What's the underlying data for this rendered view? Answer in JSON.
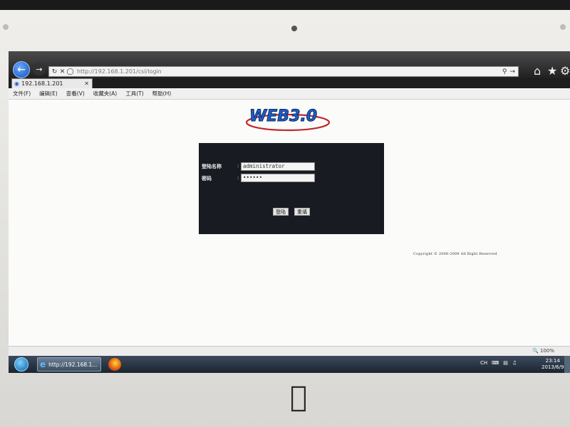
{
  "browser": {
    "address_url": "http://192.168.1.201/csl/login",
    "tab_title": "192.168.1.201",
    "menu": [
      {
        "label": "文件(F)"
      },
      {
        "label": "编辑(E)"
      },
      {
        "label": "查看(V)"
      },
      {
        "label": "收藏夹(A)"
      },
      {
        "label": "工具(T)"
      },
      {
        "label": "帮助(H)"
      }
    ],
    "zoom": "100%",
    "icons": {
      "back": "back-arrow-icon",
      "forward": "forward-arrow-icon",
      "home": "home-icon",
      "favorites": "star-icon",
      "tools": "gear-icon"
    }
  },
  "page": {
    "logo_text": "WEB3.0",
    "login": {
      "username_label": "登陆名称",
      "username_value": "administrator",
      "password_label": "密码",
      "password_value": "••••••",
      "colon": ":",
      "login_button": "登陆",
      "reset_button": "重填"
    },
    "copyright": "Copyright © 2006-2009 All Right Reserved"
  },
  "taskbar": {
    "ie_task_label": "http://192.168.1...",
    "tray_lang": "CH",
    "time": "23:14",
    "date": "2013/6/9"
  },
  "colors": {
    "login_box": "#191b22",
    "logo_blue": "#1f5fc8",
    "logo_swoosh": "#c0282d"
  }
}
